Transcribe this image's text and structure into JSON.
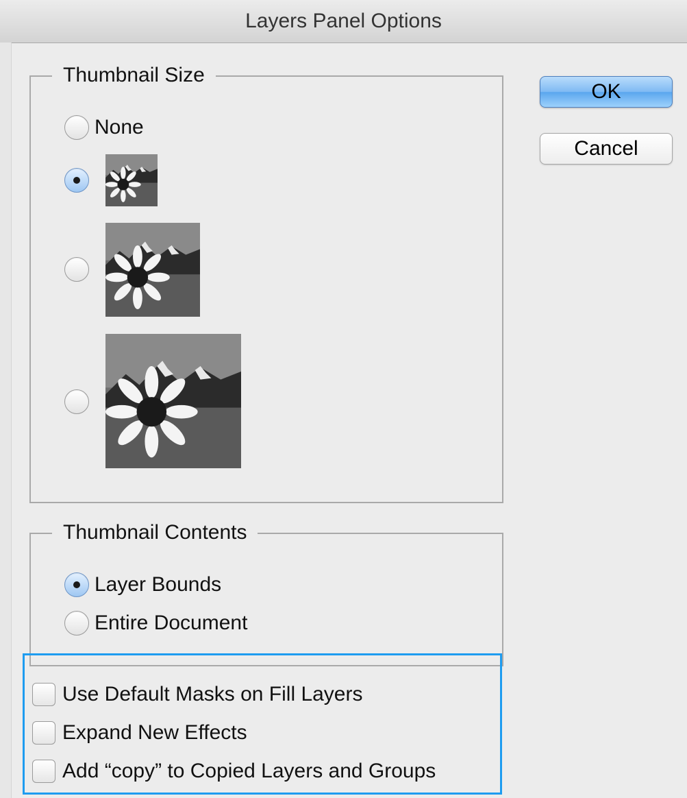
{
  "window": {
    "title": "Layers Panel Options"
  },
  "thumbnail_size": {
    "label": "Thumbnail Size",
    "options": [
      {
        "label": "None",
        "checked": false
      },
      {
        "label": "",
        "checked": true
      },
      {
        "label": "",
        "checked": false
      },
      {
        "label": "",
        "checked": false
      }
    ]
  },
  "thumbnail_contents": {
    "label": "Thumbnail Contents",
    "options": [
      {
        "label": "Layer Bounds",
        "checked": true
      },
      {
        "label": "Entire Document",
        "checked": false
      }
    ]
  },
  "checkboxes": [
    {
      "label": "Use Default Masks on Fill Layers",
      "checked": false
    },
    {
      "label": "Expand New Effects",
      "checked": false
    },
    {
      "label": "Add “copy” to Copied Layers and Groups",
      "checked": false
    }
  ],
  "buttons": {
    "ok": "OK",
    "cancel": "Cancel"
  },
  "colors": {
    "ok_button": "#7fbaf3",
    "highlight_border": "#1e9cf0",
    "background": "#ececec"
  }
}
